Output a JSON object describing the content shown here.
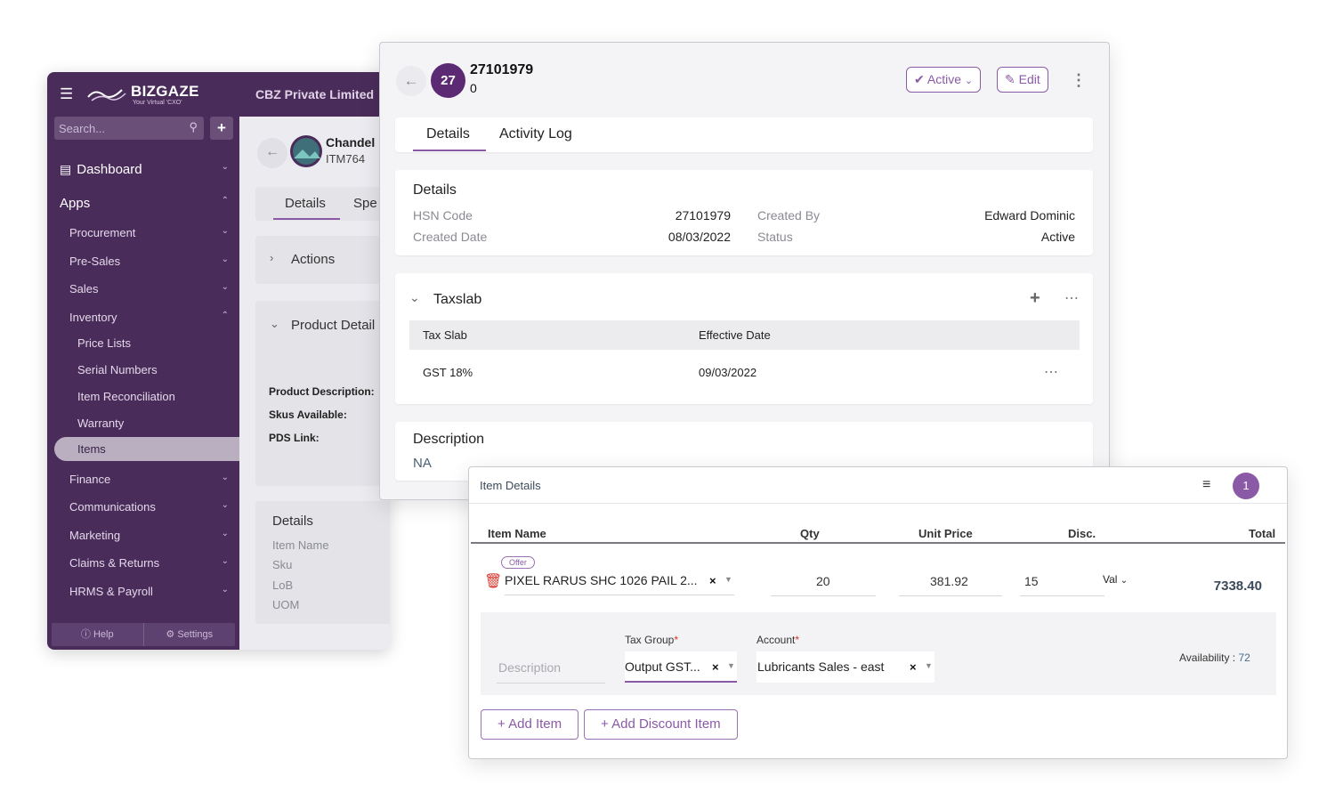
{
  "brand": {
    "name": "BIZGAZE",
    "tagline": "Your Virtual 'CXO'",
    "company": "CBZ Private Limited"
  },
  "sidebar": {
    "search_placeholder": "Search...",
    "plus": "+",
    "dashboard": "Dashboard",
    "apps": "Apps",
    "items": [
      "Procurement",
      "Pre-Sales",
      "Sales",
      "Inventory"
    ],
    "inventory_sub": [
      "Price Lists",
      "Serial Numbers",
      "Item Reconciliation",
      "Warranty",
      "Items"
    ],
    "more_items": [
      "Finance",
      "Communications",
      "Marketing",
      "Claims & Returns",
      "HRMS & Payroll"
    ],
    "help": "Help",
    "settings": "Settings"
  },
  "bg_detail": {
    "name": "Chandel",
    "code": "ITM764",
    "tabs": [
      "Details",
      "Spe"
    ],
    "actions": "Actions",
    "product_detail": "Product Detail",
    "fields": [
      "Product Description:",
      "Skus Available:",
      "PDS Link:"
    ],
    "details_title": "Details",
    "details_fields": [
      "Item Name",
      "Sku",
      "LoB",
      "UOM"
    ]
  },
  "modal": {
    "avatar": "27",
    "title": "27101979",
    "subtitle": "0",
    "status_btn": "Active",
    "edit_btn": "Edit",
    "tabs": [
      "Details",
      "Activity Log"
    ],
    "details": {
      "title": "Details",
      "hsn_label": "HSN Code",
      "hsn_value": "27101979",
      "created_date_label": "Created Date",
      "created_date_value": "08/03/2022",
      "created_by_label": "Created By",
      "created_by_value": "Edward Dominic",
      "status_label": "Status",
      "status_value": "Active"
    },
    "taxslab": {
      "title": "Taxslab",
      "headers": [
        "Tax Slab",
        "Effective Date"
      ],
      "rows": [
        {
          "slab": "GST 18%",
          "date": "09/03/2022"
        }
      ]
    },
    "description": {
      "title": "Description",
      "value": "NA"
    }
  },
  "item_panel": {
    "title": "Item Details",
    "badge": "1",
    "headers": {
      "name": "Item Name",
      "qty": "Qty",
      "unit_price": "Unit Price",
      "disc": "Disc.",
      "total": "Total"
    },
    "row": {
      "tag": "Offer",
      "name": "PIXEL RARUS SHC 1026 PAIL 2...",
      "qty": "20",
      "unit_price": "381.92",
      "disc": "15",
      "disc_type": "Val",
      "total": "7338.40"
    },
    "description_placeholder": "Description",
    "tax_group_label": "Tax Group",
    "tax_group_value": "Output GST...",
    "account_label": "Account",
    "account_value": "Lubricants Sales - east",
    "availability_label": "Availability :",
    "availability_value": "72",
    "add_item": "+ Add Item",
    "add_discount_item": "+ Add Discount Item"
  },
  "colors": {
    "brand_purple": "#4a2c5a",
    "accent": "#8b5aa6",
    "avatar": "#5b2a73",
    "delete_red": "#d9342b"
  }
}
